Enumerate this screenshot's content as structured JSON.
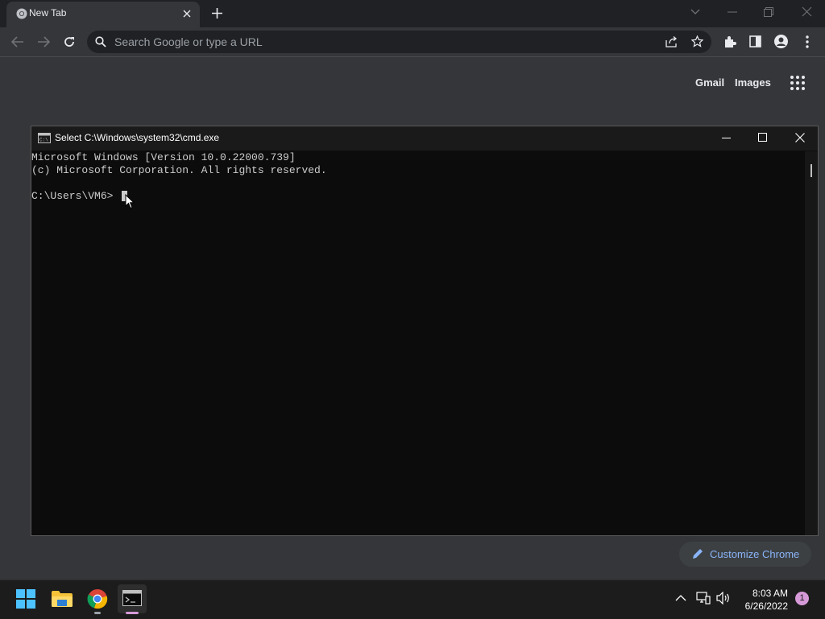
{
  "browser": {
    "tab_title": "New Tab",
    "tab_icon": "chrome-icon",
    "omnibox_placeholder": "Search Google or type a URL"
  },
  "ntp": {
    "gmail": "Gmail",
    "images": "Images",
    "customize": "Customize Chrome"
  },
  "cmd": {
    "title": "Select C:\\Windows\\system32\\cmd.exe",
    "lines": [
      "Microsoft Windows [Version 10.0.22000.739]",
      "(c) Microsoft Corporation. All rights reserved.",
      "",
      "C:\\Users\\VM6>"
    ]
  },
  "taskbar": {
    "time": "8:03 AM",
    "date": "6/26/2022",
    "notifications": "1",
    "apps": [
      "start-icon",
      "file-explorer-icon",
      "chrome-icon",
      "terminal-icon"
    ]
  },
  "colors": {
    "chrome_bg": "#35363a",
    "terminal_bg": "#0c0c0c",
    "accent": "#8ab4f8"
  }
}
